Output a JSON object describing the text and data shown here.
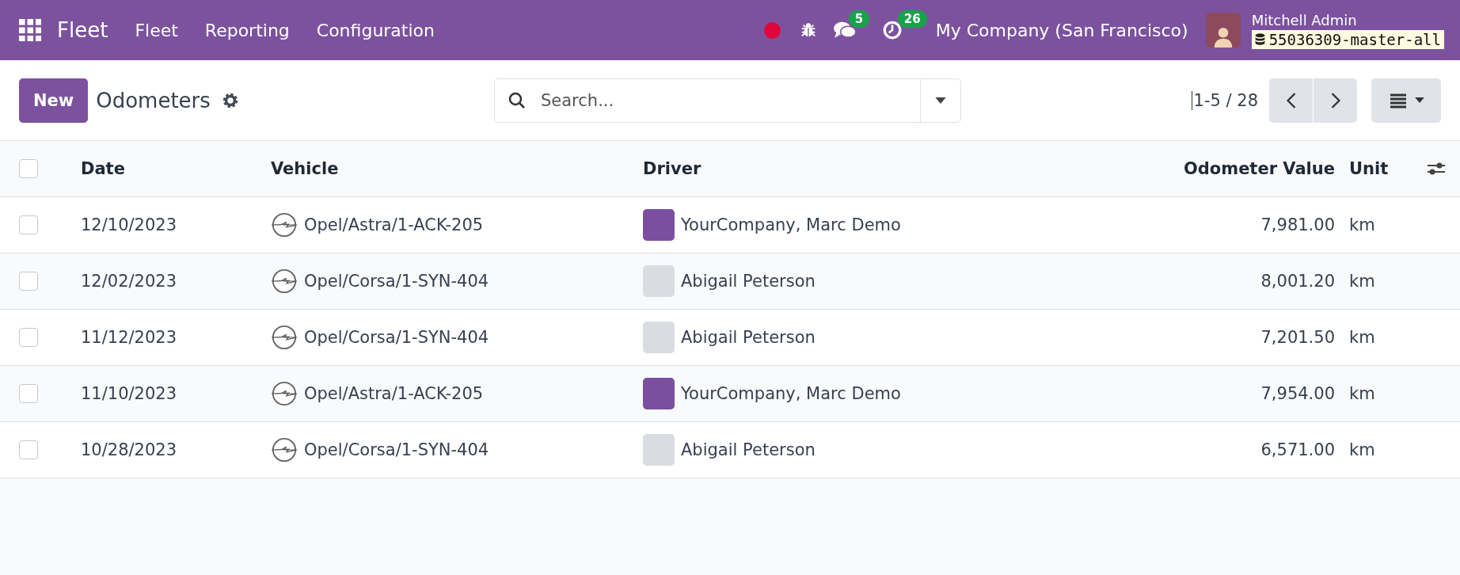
{
  "navbar": {
    "app_name": "Fleet",
    "menu": [
      "Fleet",
      "Reporting",
      "Configuration"
    ],
    "messages_count": "5",
    "activities_count": "26",
    "company": "My Company (San Francisco)",
    "user": "Mitchell Admin",
    "database": "55036309-master-all"
  },
  "control_panel": {
    "new_button": "New",
    "title": "Odometers",
    "search": {
      "placeholder": "Search..."
    },
    "pager": "1-5 / 28"
  },
  "table": {
    "select_all_checked": false,
    "columns": [
      "Date",
      "Vehicle",
      "Driver",
      "Odometer Value",
      "Unit"
    ],
    "rows": [
      {
        "checked": false,
        "date": "12/10/2023",
        "vehicle": "Opel/Astra/1-ACK-205",
        "driver": "YourCompany, Marc Demo",
        "color": "#7b4fa0",
        "value": "7,981.00",
        "unit": "km"
      },
      {
        "checked": false,
        "date": "12/02/2023",
        "vehicle": "Opel/Corsa/1-SYN-404",
        "driver": "Abigail Peterson",
        "color": "#d9dde2",
        "value": "8,001.20",
        "unit": "km"
      },
      {
        "checked": false,
        "date": "11/12/2023",
        "vehicle": "Opel/Corsa/1-SYN-404",
        "driver": "Abigail Peterson",
        "color": "#d9dde2",
        "value": "7,201.50",
        "unit": "km"
      },
      {
        "checked": false,
        "date": "11/10/2023",
        "vehicle": "Opel/Astra/1-ACK-205",
        "driver": "YourCompany, Marc Demo",
        "color": "#7b4fa0",
        "value": "7,954.00",
        "unit": "km"
      },
      {
        "checked": false,
        "date": "10/28/2023",
        "vehicle": "Opel/Corsa/1-SYN-404",
        "driver": "Abigail Peterson",
        "color": "#d9dde2",
        "value": "6,571.00",
        "unit": "km"
      }
    ]
  }
}
